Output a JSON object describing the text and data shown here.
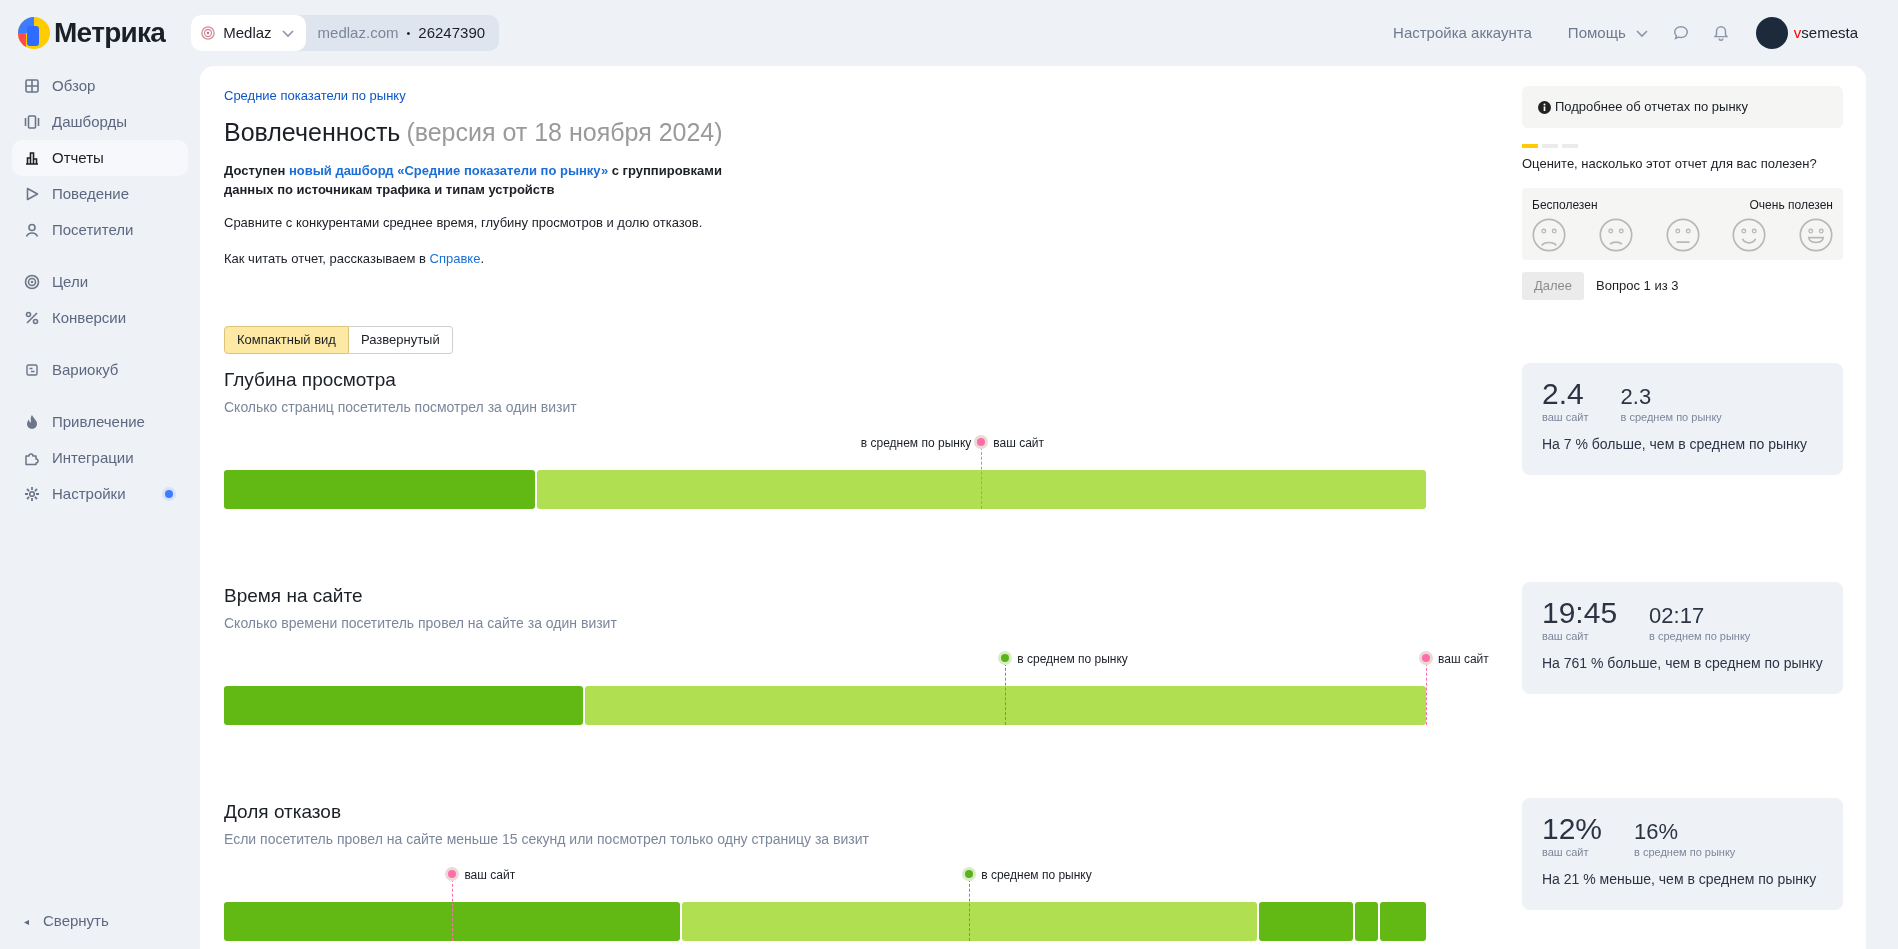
{
  "header": {
    "logo": "Метрика",
    "counter": {
      "name": "Medlaz",
      "domain": "medlaz.com",
      "separator": "•",
      "id": "26247390"
    },
    "links": [
      "Настройка аккаунта",
      "Помощь"
    ],
    "user": "vsemesta"
  },
  "sidebar": {
    "groups": [
      [
        {
          "label": "Обзор",
          "kind": "grid",
          "selected": false,
          "badge": false
        },
        {
          "label": "Дашборды",
          "kind": "dash",
          "selected": false,
          "badge": false
        },
        {
          "label": "Отчеты",
          "kind": "bars",
          "selected": true,
          "badge": false
        },
        {
          "label": "Поведение",
          "kind": "play",
          "selected": false,
          "badge": false
        },
        {
          "label": "Посетители",
          "kind": "user",
          "selected": false,
          "badge": false
        }
      ],
      [
        {
          "label": "Цели",
          "kind": "target",
          "selected": false,
          "badge": false
        },
        {
          "label": "Конверсии",
          "kind": "percent",
          "selected": false,
          "badge": false
        }
      ],
      [
        {
          "label": "Вариокуб",
          "kind": "cube",
          "selected": false,
          "badge": false
        }
      ],
      [
        {
          "label": "Привлечение",
          "kind": "fire",
          "selected": false,
          "badge": false
        },
        {
          "label": "Интеграции",
          "kind": "puzzle",
          "selected": false,
          "badge": false
        },
        {
          "label": "Настройки",
          "kind": "gear",
          "selected": false,
          "badge": true
        }
      ]
    ],
    "collapse": {
      "icon": "◂",
      "label": "Свернуть"
    }
  },
  "report": {
    "breadcrumb": "Средние показатели по рынку",
    "title": "Вовлеченность",
    "version": "(версия от 18 ноября 2024)",
    "notice": {
      "before": "Доступен",
      "link": "новый дашборд «Средние показатели по рынку»",
      "after": "с группировками данных по источникам трафика и типам устройств"
    },
    "description": "Сравните с конкурентами среднее время, глубину просмотров и долю отказов.",
    "help": {
      "before": "Как читать отчет, рассказываем в",
      "link": "Справке",
      "after": "."
    },
    "views": [
      {
        "label": "Компактный вид",
        "selected": true
      },
      {
        "label": "Развернутый",
        "selected": false
      }
    ]
  },
  "feedback": {
    "info": "Подробнее об отчетах по рынку",
    "steps": [
      {
        "active": true
      },
      {
        "active": false
      },
      {
        "active": false
      }
    ],
    "question": "Оцените, насколько этот отчет для вас полезен?",
    "low_label": "Бесполезен",
    "high_label": "Очень полезен",
    "faces": [
      {
        "kind": "very-sad",
        "selected": false
      },
      {
        "kind": "sad",
        "selected": false
      },
      {
        "kind": "neutral",
        "selected": false
      },
      {
        "kind": "happy",
        "selected": false
      },
      {
        "kind": "very-happy",
        "selected": false
      }
    ],
    "next_button": {
      "label": "Далее",
      "disabled": true
    },
    "progress": "Вопрос 1 из 3"
  },
  "metrics": [
    {
      "title": "Глубина просмотра",
      "subtitle": "Сколько страниц посетитель посмотрел за один визит",
      "markers": [
        {
          "kind": "market",
          "label": "в среднем по рынку"
        },
        {
          "kind": "site",
          "label": "ваш сайт"
        }
      ],
      "site_value": "2.4",
      "site_label": "ваш сайт",
      "market_value": "2.3",
      "market_label": "в среднем по рынку",
      "summary": "На 7 % больше, чем в среднем по рынку"
    },
    {
      "title": "Время на сайте",
      "subtitle": "Сколько времени посетитель провел на сайте за один визит",
      "markers": [
        {
          "kind": "market",
          "label": "в среднем по рынку"
        },
        {
          "kind": "site",
          "label": "ваш сайт"
        }
      ],
      "site_value": "19:45",
      "site_label": "ваш сайт",
      "market_value": "02:17",
      "market_label": "в среднем по рынку",
      "summary": "На 761 % больше, чем в среднем по рынку"
    },
    {
      "title": "Доля отказов",
      "subtitle": "Если посетитель провел на сайте меньше 15 секунд или посмотрел только одну страницу за визит",
      "markers": [
        {
          "kind": "site",
          "label": "ваш сайт"
        },
        {
          "kind": "market",
          "label": "в среднем по рынку"
        }
      ],
      "site_value": "12%",
      "site_label": "ваш сайт",
      "market_value": "16%",
      "market_label": "в среднем по рынку",
      "summary": "На 21 % меньше, чем в среднем по рынку"
    }
  ]
}
